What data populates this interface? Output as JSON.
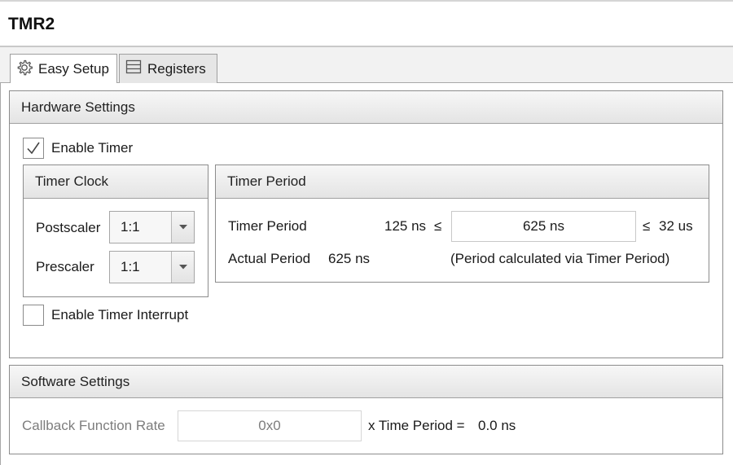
{
  "window": {
    "title": "TMR2"
  },
  "tabs": [
    {
      "label": "Easy Setup",
      "icon": "gear-icon",
      "active": true
    },
    {
      "label": "Registers",
      "icon": "registers-icon",
      "active": false
    }
  ],
  "hardware": {
    "header": "Hardware Settings",
    "enable_timer": {
      "label": "Enable Timer",
      "checked": true
    },
    "timer_clock": {
      "header": "Timer Clock",
      "postscaler": {
        "label": "Postscaler",
        "value": "1:1"
      },
      "prescaler": {
        "label": "Prescaler",
        "value": "1:1"
      }
    },
    "timer_period": {
      "header": "Timer Period",
      "period_label": "Timer Period",
      "min_text": "125 ns",
      "le_symbol": "≤",
      "value": "625 ns",
      "max_text": "32 us",
      "actual_label": "Actual Period",
      "actual_value": "625 ns",
      "note": "(Period calculated via Timer Period)"
    },
    "enable_interrupt": {
      "label": "Enable Timer Interrupt",
      "checked": false
    }
  },
  "software": {
    "header": "Software Settings",
    "callback_label": "Callback Function Rate",
    "callback_value": "0x0",
    "time_period_text": "x Time Period =",
    "time_period_value": "0.0 ns"
  },
  "colors": {
    "border": "#8c8c8c",
    "header_bg": "#e8e8e8",
    "disabled_text": "#7d7d7d"
  }
}
